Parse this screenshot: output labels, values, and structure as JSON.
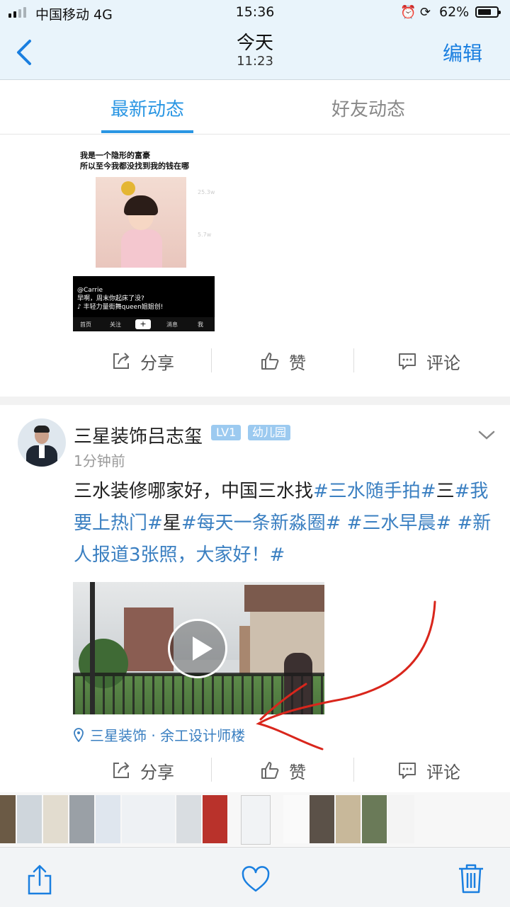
{
  "status": {
    "carrier": "中国移动 4G",
    "time": "15:36",
    "battery": "62%",
    "battery_level": 0.62
  },
  "nav": {
    "title": "今天",
    "subtitle": "11:23",
    "edit": "编辑"
  },
  "tabs": {
    "active": "最新动态",
    "inactive": "好友动态"
  },
  "post1": {
    "shot": {
      "caption_line1": "我是一个隐形的富豪",
      "caption_line2": "所以至今我都没找到我的钱在哪",
      "user": "@Carrie",
      "line2": "早啊，周末你起床了没?",
      "line3": "♪ 丰轻力量街舞queen姐姐创!",
      "side_count1": "25.3w",
      "side_count2": "5.7w",
      "tab_home": "首页",
      "tab_follow": "关注",
      "tab_plus": "+",
      "tab_msg": "消息",
      "tab_me": "我"
    }
  },
  "actions": {
    "share": "分享",
    "like": "赞",
    "comment": "评论"
  },
  "post2": {
    "username": "三星装饰吕志玺",
    "level": "LV1",
    "tag": "幼儿园",
    "time": "1分钟前",
    "text_segments": [
      {
        "text": "三水装修哪家好，中国三水找",
        "tag": false
      },
      {
        "text": "#三水随手拍#",
        "tag": true
      },
      {
        "text": "三",
        "tag": false
      },
      {
        "text": "#我要上热门#",
        "tag": true
      },
      {
        "text": "星",
        "tag": false
      },
      {
        "text": "#每天一条新淼圈# #三水早晨# #新人报道3张照，大家好！#",
        "tag": true
      }
    ],
    "location": "三星装饰 · 余工设计师楼"
  },
  "colors": {
    "accent": "#2a96e3",
    "link": "#3a7fc1",
    "nav_bg": "#e9f4fb",
    "annotation": "#d9261c"
  },
  "icons": [
    "back-chevron-icon",
    "share-icon",
    "like-icon",
    "comment-icon",
    "location-pin-icon",
    "play-icon",
    "chevron-down-icon",
    "heart-icon",
    "trash-icon"
  ]
}
